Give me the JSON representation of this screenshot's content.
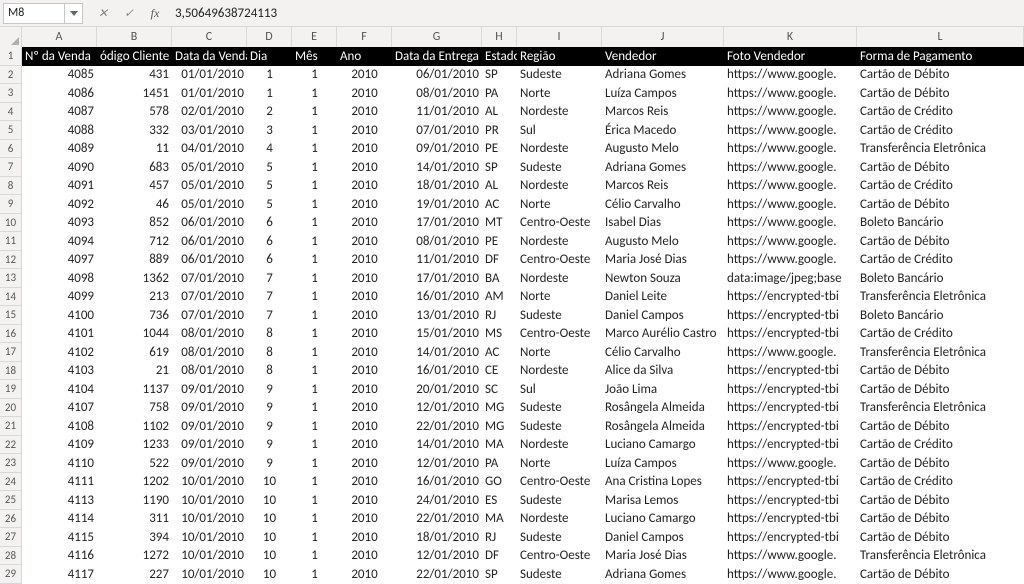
{
  "formula_bar": {
    "name_box": "M8",
    "cancel": "✕",
    "confirm": "✓",
    "fx": "fx",
    "value": "3,50649638724113"
  },
  "col_letters": [
    "A",
    "B",
    "C",
    "D",
    "E",
    "F",
    "G",
    "H",
    "I",
    "J",
    "K",
    "L"
  ],
  "col_widths": [
    "w-A",
    "w-B",
    "w-C",
    "w-D",
    "w-E",
    "w-F",
    "w-G",
    "w-H",
    "w-I",
    "w-J",
    "w-K",
    "w-L"
  ],
  "headers": [
    "Nº da Venda",
    "ódigo Cliente",
    "Data da Venda",
    "Dia",
    "Mês",
    "Ano",
    "Data da Entrega",
    "Estado",
    "Região",
    "Vendedor",
    "Foto Vendedor",
    "Forma de Pagamento"
  ],
  "header_last_extra": "R",
  "aligns": [
    "r",
    "r",
    "r",
    "c",
    "c",
    "c",
    "r",
    "l",
    "l",
    "l",
    "l",
    "l"
  ],
  "rows": [
    {
      "n": 2,
      "c": [
        "4085",
        "431",
        "01/01/2010",
        "1",
        "1",
        "2010",
        "06/01/2010",
        "SP",
        "Sudeste",
        "Adriana Gomes",
        "https://www.google.",
        "Cartão de Débito"
      ]
    },
    {
      "n": 3,
      "c": [
        "4086",
        "1451",
        "01/01/2010",
        "1",
        "1",
        "2010",
        "08/01/2010",
        "PA",
        "Norte",
        "Luíza Campos",
        "https://www.google.",
        "Cartão de Débito"
      ]
    },
    {
      "n": 4,
      "c": [
        "4087",
        "578",
        "02/01/2010",
        "2",
        "1",
        "2010",
        "11/01/2010",
        "AL",
        "Nordeste",
        "Marcos Reis",
        "https://www.google.",
        "Cartão de Crédito"
      ]
    },
    {
      "n": 5,
      "c": [
        "4088",
        "332",
        "03/01/2010",
        "3",
        "1",
        "2010",
        "07/01/2010",
        "PR",
        "Sul",
        "Érica Macedo",
        "https://www.google.",
        "Cartão de Crédito"
      ]
    },
    {
      "n": 6,
      "c": [
        "4089",
        "11",
        "04/01/2010",
        "4",
        "1",
        "2010",
        "09/01/2010",
        "PE",
        "Nordeste",
        "Augusto Melo",
        "https://www.google.",
        "Transferência Eletrônica"
      ]
    },
    {
      "n": 7,
      "c": [
        "4090",
        "683",
        "05/01/2010",
        "5",
        "1",
        "2010",
        "14/01/2010",
        "SP",
        "Sudeste",
        "Adriana Gomes",
        "https://www.google.",
        "Cartão de Débito"
      ]
    },
    {
      "n": 8,
      "c": [
        "4091",
        "457",
        "05/01/2010",
        "5",
        "1",
        "2010",
        "18/01/2010",
        "AL",
        "Nordeste",
        "Marcos Reis",
        "https://www.google.",
        "Cartão de Crédito"
      ]
    },
    {
      "n": 9,
      "c": [
        "4092",
        "46",
        "05/01/2010",
        "5",
        "1",
        "2010",
        "19/01/2010",
        "AC",
        "Norte",
        "Célio Carvalho",
        "https://www.google.",
        "Cartão de Débito"
      ]
    },
    {
      "n": 10,
      "c": [
        "4093",
        "852",
        "06/01/2010",
        "6",
        "1",
        "2010",
        "17/01/2010",
        "MT",
        "Centro-Oeste",
        "Isabel Dias",
        "https://www.google.",
        "Boleto Bancário"
      ]
    },
    {
      "n": 11,
      "c": [
        "4094",
        "712",
        "06/01/2010",
        "6",
        "1",
        "2010",
        "08/01/2010",
        "PE",
        "Nordeste",
        "Augusto Melo",
        "https://www.google.",
        "Cartão de Débito"
      ]
    },
    {
      "n": 12,
      "c": [
        "4097",
        "889",
        "06/01/2010",
        "6",
        "1",
        "2010",
        "11/01/2010",
        "DF",
        "Centro-Oeste",
        "Maria José Dias",
        "https://www.google.",
        "Cartão de Crédito"
      ]
    },
    {
      "n": 13,
      "c": [
        "4098",
        "1362",
        "07/01/2010",
        "7",
        "1",
        "2010",
        "17/01/2010",
        "BA",
        "Nordeste",
        "Newton Souza",
        "data:image/jpeg;base",
        "Boleto Bancário"
      ]
    },
    {
      "n": 14,
      "c": [
        "4099",
        "213",
        "07/01/2010",
        "7",
        "1",
        "2010",
        "16/01/2010",
        "AM",
        "Norte",
        "Daniel Leite",
        "https://encrypted-tbi",
        "Transferência Eletrônica"
      ]
    },
    {
      "n": 15,
      "c": [
        "4100",
        "736",
        "07/01/2010",
        "7",
        "1",
        "2010",
        "13/01/2010",
        "RJ",
        "Sudeste",
        "Daniel Campos",
        "https://encrypted-tbi",
        "Boleto Bancário"
      ]
    },
    {
      "n": 16,
      "c": [
        "4101",
        "1044",
        "08/01/2010",
        "8",
        "1",
        "2010",
        "15/01/2010",
        "MS",
        "Centro-Oeste",
        "Marco Aurélio Castro",
        "https://encrypted-tbi",
        "Cartão de Crédito"
      ]
    },
    {
      "n": 17,
      "c": [
        "4102",
        "619",
        "08/01/2010",
        "8",
        "1",
        "2010",
        "14/01/2010",
        "AC",
        "Norte",
        "Célio Carvalho",
        "https://www.google.",
        "Transferência Eletrônica"
      ]
    },
    {
      "n": 18,
      "c": [
        "4103",
        "21",
        "08/01/2010",
        "8",
        "1",
        "2010",
        "16/01/2010",
        "CE",
        "Nordeste",
        "Alice da Silva",
        "https://encrypted-tbi",
        "Cartão de Débito"
      ]
    },
    {
      "n": 19,
      "c": [
        "4104",
        "1137",
        "09/01/2010",
        "9",
        "1",
        "2010",
        "20/01/2010",
        "SC",
        "Sul",
        "João Lima",
        "https://encrypted-tbi",
        "Cartão de Débito"
      ]
    },
    {
      "n": 20,
      "c": [
        "4107",
        "758",
        "09/01/2010",
        "9",
        "1",
        "2010",
        "12/01/2010",
        "MG",
        "Sudeste",
        "Rosângela Almeida",
        "https://encrypted-tbi",
        "Transferência Eletrônica"
      ]
    },
    {
      "n": 21,
      "c": [
        "4108",
        "1102",
        "09/01/2010",
        "9",
        "1",
        "2010",
        "22/01/2010",
        "MG",
        "Sudeste",
        "Rosângela Almeida",
        "https://encrypted-tbi",
        "Cartão de Débito"
      ]
    },
    {
      "n": 22,
      "c": [
        "4109",
        "1233",
        "09/01/2010",
        "9",
        "1",
        "2010",
        "14/01/2010",
        "MA",
        "Nordeste",
        "Luciano Camargo",
        "https://encrypted-tbi",
        "Cartão de Crédito"
      ]
    },
    {
      "n": 23,
      "c": [
        "4110",
        "522",
        "09/01/2010",
        "9",
        "1",
        "2010",
        "12/01/2010",
        "PA",
        "Norte",
        "Luíza Campos",
        "https://www.google.",
        "Cartão de Débito"
      ]
    },
    {
      "n": 24,
      "c": [
        "4111",
        "1202",
        "10/01/2010",
        "10",
        "1",
        "2010",
        "16/01/2010",
        "GO",
        "Centro-Oeste",
        "Ana Cristina Lopes",
        "https://encrypted-tbi",
        "Cartão de Crédito"
      ]
    },
    {
      "n": 25,
      "c": [
        "4113",
        "1190",
        "10/01/2010",
        "10",
        "1",
        "2010",
        "24/01/2010",
        "ES",
        "Sudeste",
        "Marisa Lemos",
        "https://encrypted-tbi",
        "Cartão de Débito"
      ]
    },
    {
      "n": 26,
      "c": [
        "4114",
        "311",
        "10/01/2010",
        "10",
        "1",
        "2010",
        "22/01/2010",
        "MA",
        "Nordeste",
        "Luciano Camargo",
        "https://encrypted-tbi",
        "Cartão de Débito"
      ]
    },
    {
      "n": 27,
      "c": [
        "4115",
        "394",
        "10/01/2010",
        "10",
        "1",
        "2010",
        "18/01/2010",
        "RJ",
        "Sudeste",
        "Daniel Campos",
        "https://encrypted-tbi",
        "Cartão de Débito"
      ]
    },
    {
      "n": 28,
      "c": [
        "4116",
        "1272",
        "10/01/2010",
        "10",
        "1",
        "2010",
        "12/01/2010",
        "DF",
        "Centro-Oeste",
        "Maria José Dias",
        "https://www.google.",
        "Transferência Eletrônica"
      ]
    },
    {
      "n": 29,
      "c": [
        "4117",
        "227",
        "10/01/2010",
        "10",
        "1",
        "2010",
        "22/01/2010",
        "SP",
        "Sudeste",
        "Adriana Gomes",
        "https://www.google.",
        "Cartão de Débito"
      ]
    }
  ]
}
